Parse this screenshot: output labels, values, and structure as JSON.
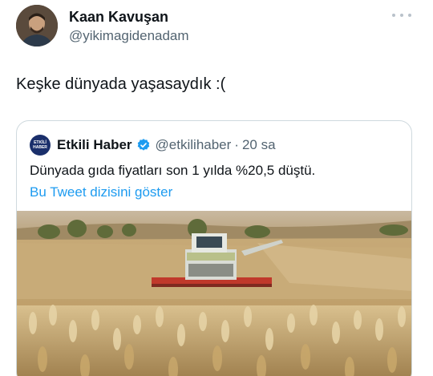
{
  "tweet": {
    "author_name": "Kaan Kavuşan",
    "author_handle": "@yikimagidenadam",
    "text": "Keşke dünyada yaşasaydık :("
  },
  "quoted_tweet": {
    "source_logo_text": "ETKİLİ HABER",
    "author_name": "Etkili Haber",
    "author_handle": "@etkilihaber",
    "separator": "·",
    "time": "20 sa",
    "text": "Dünyada gıda fiyatları son 1 yılda %20,5 düştü.",
    "thread_link": "Bu Tweet dizisini göster",
    "image_description_icon": "wheat-field-harvester-photo"
  },
  "colors": {
    "text_primary": "#0f1419",
    "text_secondary": "#536471",
    "link": "#1d9bf0",
    "verified": "#1d9bf0",
    "border": "#cfd9de"
  }
}
